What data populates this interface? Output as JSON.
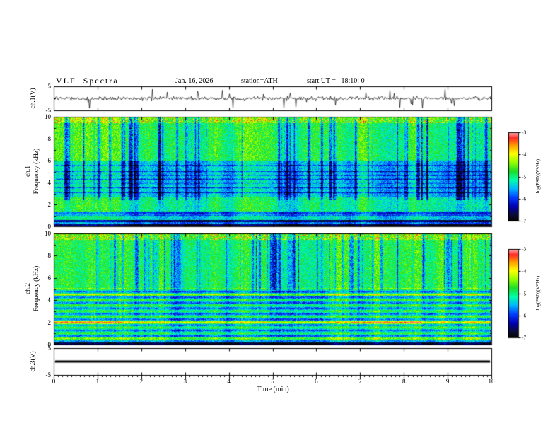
{
  "title": {
    "main": "VLF  Spectra",
    "date": "Jan. 16, 2026",
    "station": "station=ATH",
    "start_ut": "start UT =   18:10: 0"
  },
  "xaxis": {
    "label": "Time  (min)",
    "min": 0,
    "max": 10,
    "major_ticks": [
      0,
      1,
      2,
      3,
      4,
      5,
      6,
      7,
      8,
      9,
      10
    ],
    "minor_tick_step": 0.1
  },
  "panels": [
    {
      "id": "ch1_wave",
      "type": "line",
      "ylabel": "ch.1(V)",
      "ymin": -5,
      "ymax": 5,
      "yticks": [
        5,
        -5
      ]
    },
    {
      "id": "ch1_spec",
      "type": "heatmap",
      "ylabel_line1": "ch.1",
      "ylabel_line2": "Frequency (kHz)",
      "ymin": 0,
      "ymax": 10,
      "yticks": [
        10,
        8,
        6,
        4,
        2,
        0
      ]
    },
    {
      "id": "ch2_spec",
      "type": "heatmap",
      "ylabel_line1": "ch.2",
      "ylabel_line2": "Frequency (kHz)",
      "ymin": 0,
      "ymax": 10,
      "yticks": [
        10,
        8,
        6,
        4,
        2,
        0
      ]
    },
    {
      "id": "ch3_wave",
      "type": "line",
      "ylabel": "ch.3(V)",
      "ymin": -5,
      "ymax": 5,
      "yticks": [
        5,
        -5
      ]
    }
  ],
  "colorbar": {
    "label": "log(PSD)(V²/Hz)",
    "ticks": [
      -3,
      -4,
      -5,
      -6,
      -7
    ],
    "min": -7,
    "max": -3,
    "colormap_stops": [
      [
        0.0,
        [
          5,
          5,
          5
        ]
      ],
      [
        0.07,
        [
          10,
          10,
          60
        ]
      ],
      [
        0.16,
        [
          0,
          0,
          180
        ]
      ],
      [
        0.26,
        [
          0,
          60,
          255
        ]
      ],
      [
        0.36,
        [
          0,
          180,
          255
        ]
      ],
      [
        0.46,
        [
          0,
          255,
          170
        ]
      ],
      [
        0.56,
        [
          30,
          220,
          40
        ]
      ],
      [
        0.66,
        [
          150,
          255,
          0
        ]
      ],
      [
        0.76,
        [
          255,
          255,
          0
        ]
      ],
      [
        0.86,
        [
          255,
          150,
          0
        ]
      ],
      [
        0.94,
        [
          255,
          40,
          40
        ]
      ],
      [
        1.0,
        [
          255,
          175,
          175
        ]
      ]
    ]
  },
  "chart_data": [
    {
      "type": "line",
      "name": "ch.1(V) time series",
      "xlabel": "Time (min)",
      "ylabel": "ch.1(V)",
      "xlim": [
        0,
        10
      ],
      "ylim": [
        -5,
        5
      ],
      "description": "Broadband noise centered on 0 V with an envelope of roughly ±0.7 V and frequent narrow impulsive spikes (sferics) reaching about ±4 V throughout the 10-minute record.",
      "gen": {
        "seed": 913577,
        "noise_amp": 0.42,
        "spike_prob": 0.04,
        "spike_amp_min": 1.5,
        "spike_amp_max": 4.2
      }
    },
    {
      "type": "heatmap",
      "name": "ch.1 VLF spectrogram",
      "xlabel": "Time (min)",
      "ylabel": "ch.1 Frequency (kHz)",
      "value_label": "log(PSD)(V²/Hz)",
      "xlim": [
        0,
        10
      ],
      "ylim": [
        0,
        10
      ],
      "value_range": [
        -7,
        -3
      ],
      "description": "Dense broadband VLF power near -4.5 to -5 (green/cyan) with many vertical blue dropout streaks; 2.5-6 kHz region darker (blue, ~-6); thin dark horizontal interference lines near 3-5.5 kHz; cyan band 0.5-1 kHz; black band below ~0.2 kHz; reddish speckle (~-3.5) near the 10 kHz top edge.",
      "gen": {
        "seed": 424242,
        "bands": [
          {
            "fmax": 0.15,
            "v": 0.05
          },
          {
            "fmax": 0.38,
            "v": 0.3
          },
          {
            "fmax": 0.52,
            "v": 0.1
          },
          {
            "fmax": 1.05,
            "v": 0.42
          },
          {
            "fmax": 1.3,
            "v": 0.26
          },
          {
            "fmax": 2.6,
            "v": 0.5
          },
          {
            "fmax": 6.0,
            "v": 0.4
          },
          {
            "fmax": 9.45,
            "v": 0.54
          },
          {
            "fmax": 10.0,
            "v": 0.6
          }
        ],
        "dark_lines": [
          1.0,
          3.05,
          3.5,
          3.95,
          4.3,
          4.65,
          5.0,
          5.55
        ],
        "streak_fmin": 1.3,
        "streak_full_fmin": 2.4,
        "streak_strength": 0.55
      }
    },
    {
      "type": "heatmap",
      "name": "ch.2 VLF spectrogram",
      "xlabel": "Time (min)",
      "ylabel": "ch.2 Frequency (kHz)",
      "value_label": "log(PSD)(V²/Hz)",
      "xlim": [
        0,
        10
      ],
      "ylim": [
        0,
        10
      ],
      "value_range": [
        -7,
        -3
      ],
      "description": "Upper half (5-10 kHz) green with vertical blue dropout streaks like ch.1; below 5 kHz strong horizontal line structure at ~0.5 kHz spacing (yellow/green, ~-4); intense yellow-orange band near 2 kHz with red (~-3.3) segments around t=0-1.5 min and t=6.8-8.4 min; orange line near 4.5 kHz; black band below ~0.2 kHz; reddish speckle at top edge.",
      "gen": {
        "seed": 777001,
        "bands": [
          {
            "fmax": 0.15,
            "v": 0.05
          },
          {
            "fmax": 5.0,
            "v": 0.45
          },
          {
            "fmax": 9.45,
            "v": 0.54
          },
          {
            "fmax": 10.0,
            "v": 0.6
          }
        ],
        "harmonics": {
          "spacing": 0.5,
          "fmax": 5.1,
          "amp": 0.13
        },
        "bright_band": {
          "f": 1.95,
          "width": 0.14,
          "amp": 0.22,
          "red_segments": [
            [
              0.0,
              1.5
            ],
            [
              6.8,
              8.4
            ]
          ],
          "red_extra": 0.15
        },
        "extra_bands": [
          {
            "f": 4.5,
            "width": 0.09,
            "amp": 0.14
          },
          {
            "f": 0.55,
            "width": 0.08,
            "amp": 0.1
          }
        ],
        "dark_lines": [],
        "streak_fmin": 0.5,
        "streak_full_fmin": 4.9,
        "streak_strength": 0.5
      }
    },
    {
      "type": "line",
      "name": "ch.3(V) time series",
      "xlabel": "Time (min)",
      "ylabel": "ch.3(V)",
      "xlim": [
        0,
        10
      ],
      "ylim": [
        -5,
        5
      ],
      "description": "Constant flat thick line at 0 V for the whole record (channel inactive).",
      "gen": {
        "seed": 1,
        "constant": 0
      }
    }
  ]
}
